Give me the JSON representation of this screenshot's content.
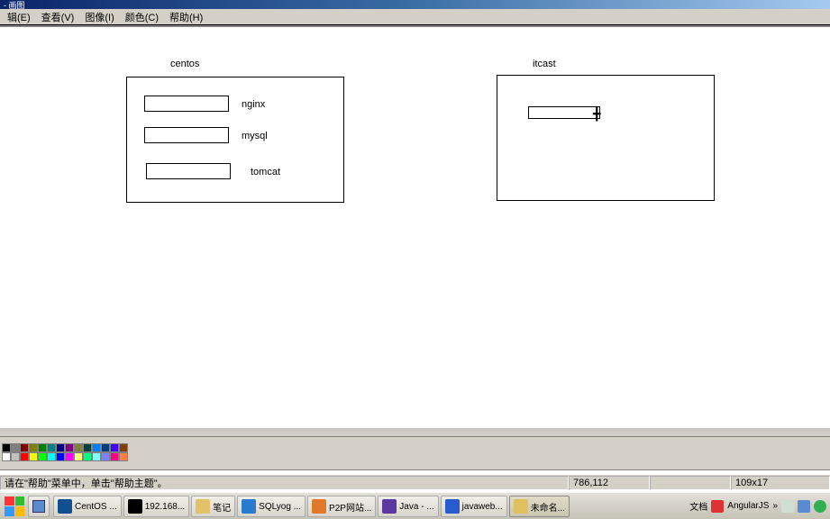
{
  "titlebar": {
    "title": "- 画图"
  },
  "menubar": {
    "items": [
      {
        "label": "辑(E)"
      },
      {
        "label": "查看(V)"
      },
      {
        "label": "图像(I)"
      },
      {
        "label": "颜色(C)"
      },
      {
        "label": "帮助(H)"
      }
    ]
  },
  "canvas": {
    "centos": {
      "title": "centos",
      "items": [
        {
          "label": "nginx"
        },
        {
          "label": "mysql"
        },
        {
          "label": "tomcat"
        }
      ]
    },
    "itcast": {
      "title": "itcast"
    }
  },
  "palette": {
    "row1": [
      "#000000",
      "#808080",
      "#800000",
      "#808000",
      "#008000",
      "#008080",
      "#000080",
      "#800080",
      "#808040",
      "#004040",
      "#0080ff",
      "#004080",
      "#4000ff",
      "#804000"
    ],
    "row2": [
      "#ffffff",
      "#c0c0c0",
      "#ff0000",
      "#ffff00",
      "#00ff00",
      "#00ffff",
      "#0000ff",
      "#ff00ff",
      "#ffff80",
      "#00ff80",
      "#80ffff",
      "#8080ff",
      "#ff0080",
      "#ff8040"
    ]
  },
  "status": {
    "help": "请在\"帮助\"菜单中，单击\"帮助主题\"。",
    "coords": "786,112",
    "size": "109x17"
  },
  "taskbar": {
    "items": [
      {
        "label": "CentOS ...",
        "icon_color": "#105090"
      },
      {
        "label": "192.168...",
        "icon_color": "#000"
      },
      {
        "label": "笔记",
        "icon_color": "#e3c06a"
      },
      {
        "label": "SQLyog ...",
        "icon_color": "#2a7ad0"
      },
      {
        "label": "P2P网站...",
        "icon_color": "#e07a2a"
      },
      {
        "label": "Java - ...",
        "icon_color": "#5a3aa0"
      },
      {
        "label": "javaweb...",
        "icon_color": "#2a5ad0"
      },
      {
        "label": "未命名...",
        "icon_color": "#e0c060",
        "active": true
      }
    ],
    "tray_label": "文档",
    "angular_label": "AngularJS"
  }
}
